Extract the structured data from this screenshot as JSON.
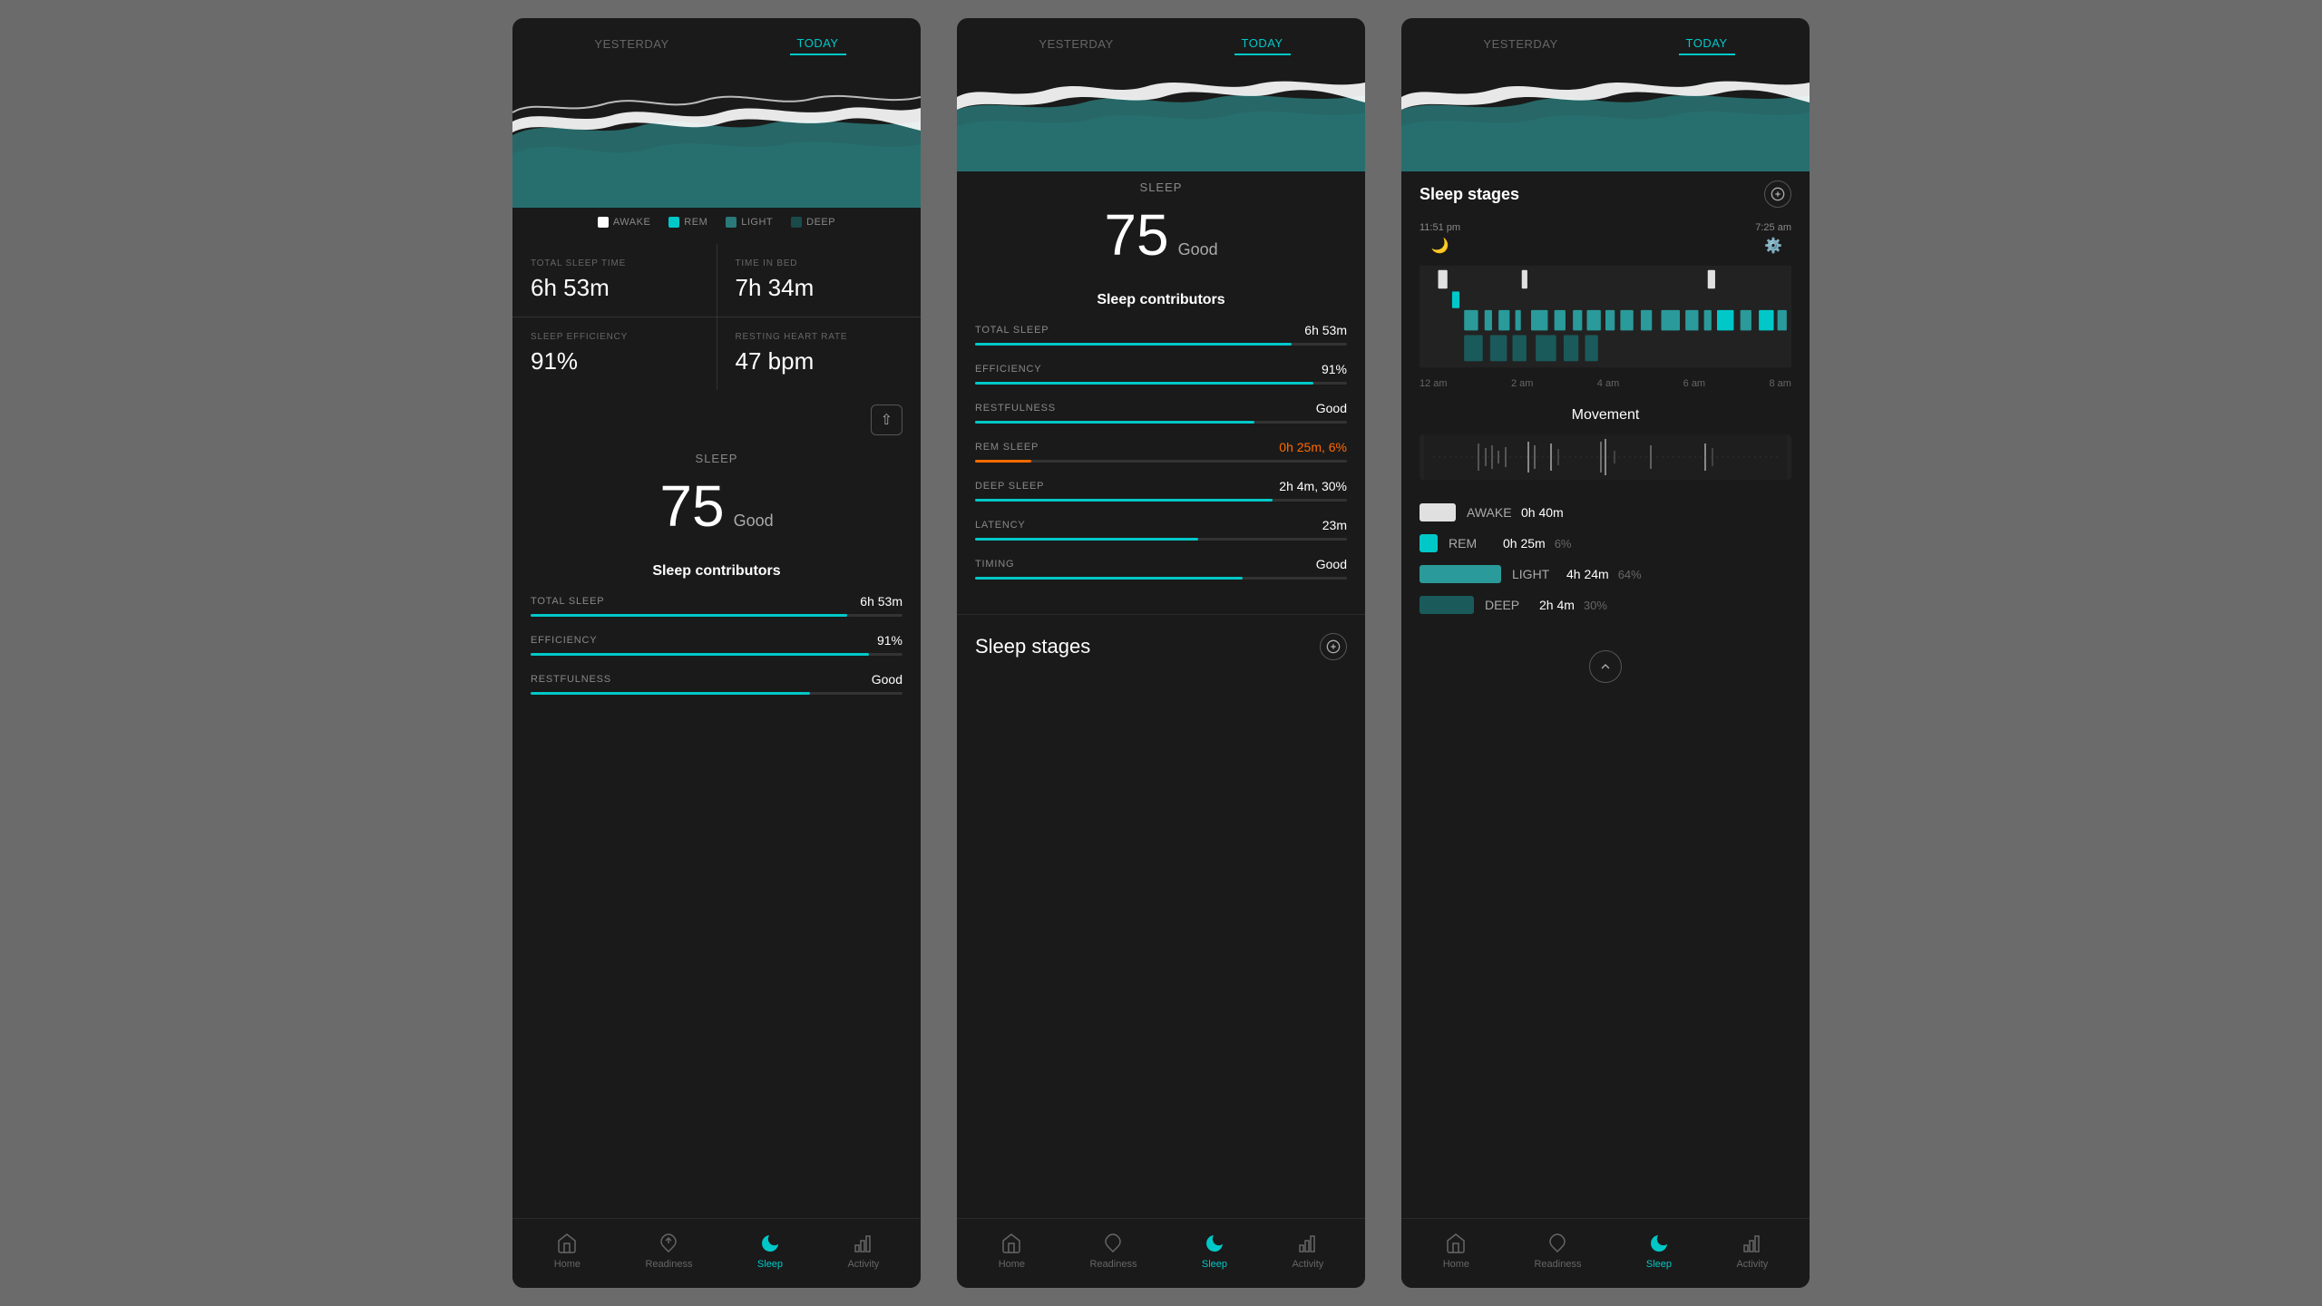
{
  "panels": [
    {
      "id": "panel1",
      "nav": {
        "yesterday": "YESTERDAY",
        "today": "TODAY",
        "active": "TODAY"
      },
      "legend": [
        {
          "label": "AWAKE",
          "color": "#ffffff"
        },
        {
          "label": "REM",
          "color": "#00c8c8"
        },
        {
          "label": "LIGHT",
          "color": "#2a7a7a"
        },
        {
          "label": "DEEP",
          "color": "#1a4a4a"
        }
      ],
      "stats": [
        {
          "label": "TOTAL SLEEP TIME",
          "value": "6h 53m"
        },
        {
          "label": "TIME IN BED",
          "value": "7h 34m"
        },
        {
          "label": "SLEEP EFFICIENCY",
          "value": "91%"
        },
        {
          "label": "RESTING HEART RATE",
          "value": "47 bpm"
        }
      ],
      "sleep": {
        "label": "SLEEP",
        "score": "75",
        "quality": "Good"
      },
      "contributors_title": "Sleep contributors",
      "contributors": [
        {
          "name": "TOTAL SLEEP",
          "value": "6h 53m",
          "pct": 85,
          "orange": false
        },
        {
          "name": "EFFICIENCY",
          "value": "91%",
          "pct": 91,
          "orange": false
        },
        {
          "name": "RESTFULNESS",
          "value": "Good",
          "pct": 75,
          "orange": false
        }
      ],
      "bottom_nav": [
        {
          "label": "Home",
          "icon": "home",
          "active": false
        },
        {
          "label": "Readiness",
          "icon": "readiness",
          "active": false
        },
        {
          "label": "Sleep",
          "icon": "sleep",
          "active": true
        },
        {
          "label": "Activity",
          "icon": "activity",
          "active": false
        }
      ]
    },
    {
      "id": "panel2",
      "nav": {
        "yesterday": "YESTERDAY",
        "today": "TODAY",
        "active": "TODAY"
      },
      "sleep": {
        "label": "SLEEP",
        "score": "75",
        "quality": "Good"
      },
      "contributors_title": "Sleep contributors",
      "contributors": [
        {
          "name": "TOTAL SLEEP",
          "value": "6h 53m",
          "pct": 85,
          "orange": false
        },
        {
          "name": "EFFICIENCY",
          "value": "91%",
          "pct": 91,
          "orange": false
        },
        {
          "name": "RESTFULNESS",
          "value": "Good",
          "pct": 75,
          "orange": false
        },
        {
          "name": "REM SLEEP",
          "value": "0h 25m, 6%",
          "pct": 15,
          "orange": true
        },
        {
          "name": "DEEP SLEEP",
          "value": "2h 4m, 30%",
          "pct": 80,
          "orange": false
        },
        {
          "name": "LATENCY",
          "value": "23m",
          "pct": 60,
          "orange": false
        },
        {
          "name": "TIMING",
          "value": "Good",
          "pct": 72,
          "orange": false
        }
      ],
      "stages_preview": "Sleep stages",
      "bottom_nav": [
        {
          "label": "Home",
          "icon": "home",
          "active": false
        },
        {
          "label": "Readiness",
          "icon": "readiness",
          "active": false
        },
        {
          "label": "Sleep",
          "icon": "sleep",
          "active": true
        },
        {
          "label": "Activity",
          "icon": "activity",
          "active": false
        }
      ]
    },
    {
      "id": "panel3",
      "nav": {
        "yesterday": "YESTERDAY",
        "today": "TODAY",
        "active": "TODAY"
      },
      "stages": {
        "title": "Sleep stages",
        "start_time": "11:51 pm",
        "end_time": "7:25 am",
        "time_axis": [
          "12 am",
          "2 am",
          "4 am",
          "6 am",
          "8 am"
        ]
      },
      "movement": {
        "title": "Movement"
      },
      "stage_legend": [
        {
          "name": "AWAKE",
          "duration": "0h 40m",
          "pct": "",
          "color": "#ffffff"
        },
        {
          "name": "REM",
          "duration": "0h 25m",
          "pct": "6%",
          "color": "#00c8c8"
        },
        {
          "name": "LIGHT",
          "duration": "4h 24m",
          "pct": "64%",
          "color": "#2a9a9a"
        },
        {
          "name": "DEEP",
          "duration": "2h 4m",
          "pct": "30%",
          "color": "#1a5a5a"
        }
      ],
      "bottom_nav": [
        {
          "label": "Home",
          "icon": "home",
          "active": false
        },
        {
          "label": "Readiness",
          "icon": "readiness",
          "active": false
        },
        {
          "label": "Sleep",
          "icon": "sleep",
          "active": true
        },
        {
          "label": "Activity",
          "icon": "activity",
          "active": false
        }
      ]
    }
  ]
}
